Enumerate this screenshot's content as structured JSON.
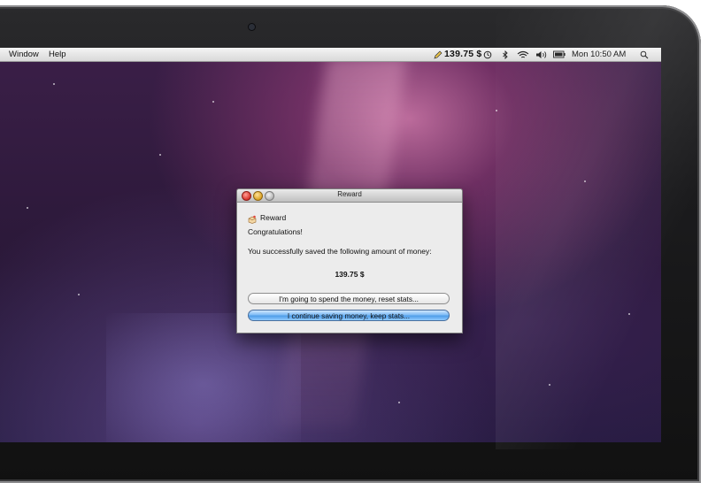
{
  "menubar": {
    "menus": [
      "Window",
      "Help"
    ],
    "status_money": "139.75 $",
    "clock": "Mon 10:50 AM",
    "icons": [
      "pencil-icon",
      "time-machine-icon",
      "bluetooth-icon",
      "wifi-icon",
      "volume-icon",
      "battery-icon",
      "spotlight-icon"
    ]
  },
  "dialog": {
    "title": "Reward",
    "heading": "Reward",
    "congrats": "Congratulations!",
    "message": "You successfully saved the following amount of money:",
    "amount": "139.75 $",
    "spend_button": "I'm going to spend the money, reset stats...",
    "continue_button": "I continue saving money, keep stats..."
  },
  "colors": {
    "primary_button": "#6fb2f2",
    "close_button": "#e0443a",
    "minimize_button": "#e9b22f",
    "desktop_bg": "#2e1a3c"
  }
}
